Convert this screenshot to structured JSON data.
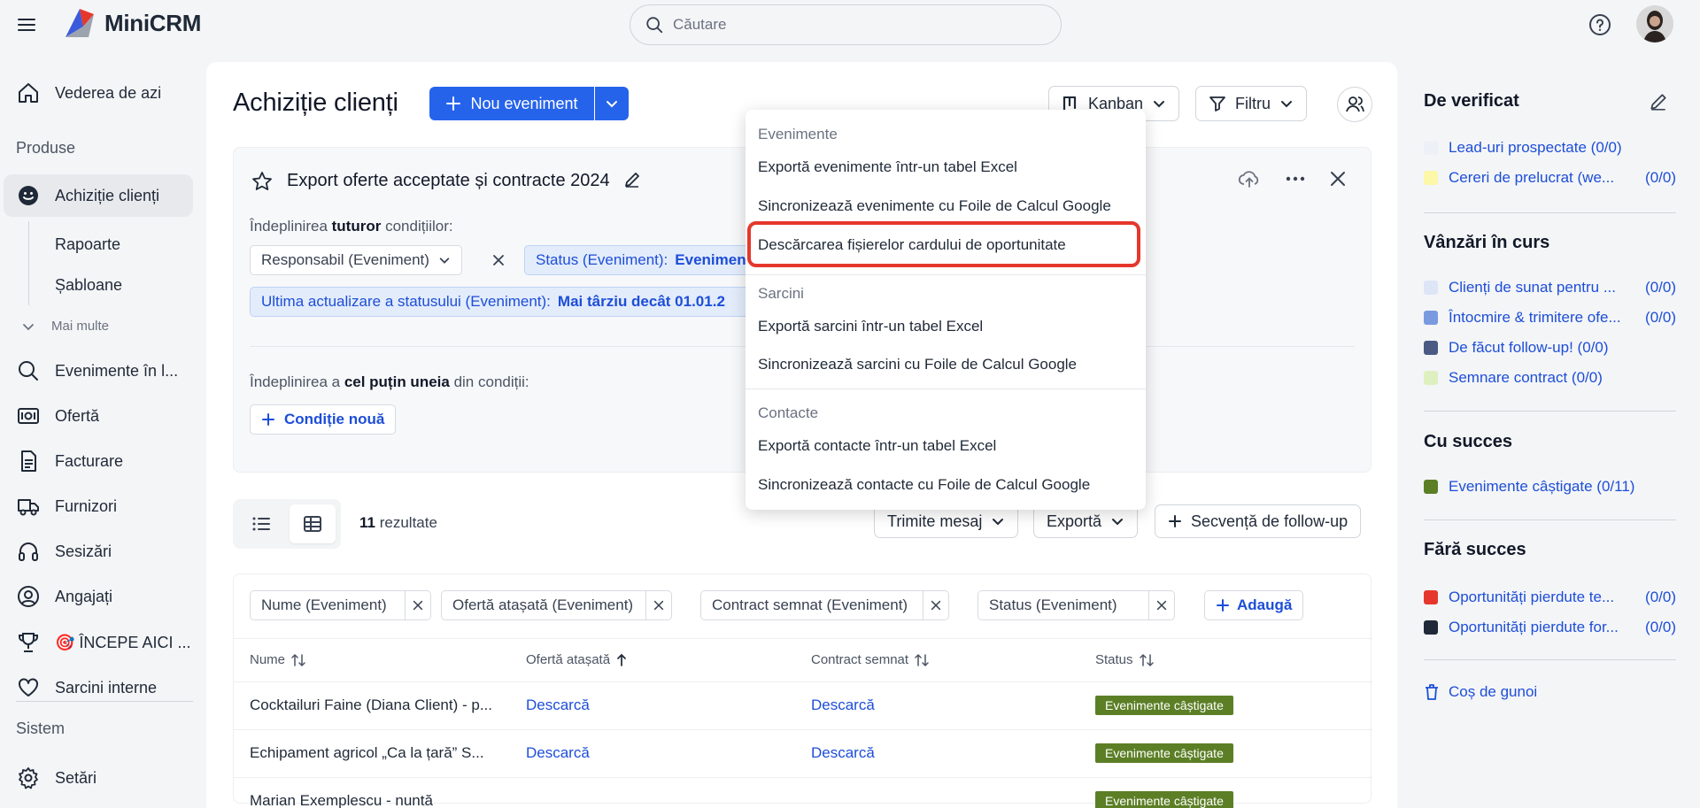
{
  "app": {
    "name": "MiniCRM",
    "search_placeholder": "Căutare"
  },
  "sidebar": {
    "items": [
      {
        "label": "Vederea de azi",
        "icon": "home-icon"
      },
      {
        "label": "Achiziție clienți",
        "icon": "smiley-icon",
        "active": true
      },
      {
        "label": "Evenimente în l...",
        "icon": "search-icon"
      },
      {
        "label": "Ofertă",
        "icon": "offer-icon"
      },
      {
        "label": "Facturare",
        "icon": "document-icon"
      },
      {
        "label": "Furnizori",
        "icon": "truck-icon"
      },
      {
        "label": "Sesizări",
        "icon": "headset-icon"
      },
      {
        "label": "Angajați",
        "icon": "user-circle-icon"
      },
      {
        "label": "🎯 ÎNCEPE AICI ...",
        "icon": "trophy-icon"
      },
      {
        "label": "Sarcini interne",
        "icon": "heart-icon"
      },
      {
        "label": "Setări",
        "icon": "gear-icon"
      }
    ],
    "section_products": "Produse",
    "section_system": "Sistem",
    "sub_items": [
      "Rapoarte",
      "Șabloane"
    ],
    "more": "Mai multe"
  },
  "main": {
    "title": "Achiziție clienți",
    "new_event": "Nou eveniment",
    "kanban": "Kanban",
    "filter": "Filtru",
    "filter_panel": {
      "title": "Export oferte acceptate și contracte 2024",
      "all_prefix": "Îndeplinirea",
      "all_bold": "tuturor",
      "all_suffix": "condițiilor:",
      "chip_responsible": "Responsabil (Eveniment)",
      "chip_status_label": "Status (Eveniment):",
      "chip_status_value": "Evenimente",
      "chip_update_label": "Ultima actualizare a statusului (Eveniment):",
      "chip_update_value": "Mai târziu decât 01.01.2",
      "any_prefix": "Îndeplinirea a",
      "any_bold": "cel puțin uneia",
      "any_suffix": "din condiții:",
      "new_condition": "Condiție nouă"
    },
    "results_count": "11",
    "results_label": "rezultate",
    "send_message": "Trimite mesaj",
    "export": "Exportă",
    "followup": "Secvență de follow-up",
    "column_chips": [
      "Nume (Eveniment)",
      "Ofertă atașată (Eveniment)",
      "Contract semnat (Eveniment)",
      "Status (Eveniment)"
    ],
    "add_column": "Adaugă",
    "table": {
      "headers": [
        "Nume",
        "Ofertă atașată",
        "Contract semnat",
        "Status"
      ],
      "rows": [
        {
          "name": "Cocktailuri Faine (Diana Client) - p...",
          "offer": "Descarcă",
          "contract": "Descarcă",
          "status": "Evenimente câștigate"
        },
        {
          "name": "Echipament agricol „Ca la țară” S...",
          "offer": "Descarcă",
          "contract": "Descarcă",
          "status": "Evenimente câștigate"
        },
        {
          "name": "Marian Exemplescu - nuntă",
          "offer": "",
          "contract": "",
          "status": "Evenimente câștigate"
        }
      ]
    }
  },
  "menu": {
    "groups": [
      {
        "header": "Evenimente",
        "items": [
          "Exportă evenimente într-un tabel Excel",
          "Sincronizează evenimente cu Foile de Calcul Google",
          "Descărcarea fișierelor cardului de oportunitate"
        ]
      },
      {
        "header": "Sarcini",
        "items": [
          "Exportă sarcini într-un tabel Excel",
          "Sincronizează sarcini cu Foile de Calcul Google"
        ]
      },
      {
        "header": "Contacte",
        "items": [
          "Exportă contacte într-un tabel Excel",
          "Sincronizează contacte cu Foile de Calcul Google"
        ]
      }
    ],
    "highlight_color": "#e5372c"
  },
  "right": {
    "sections": [
      {
        "title": "De verificat",
        "items": [
          {
            "label": "Lead-uri prospectate",
            "count": "(0/0)",
            "color": "#eef0f8"
          },
          {
            "label": "Cereri de prelucrat (we...",
            "count": "(0/0)",
            "color": "#fdf7a8"
          }
        ]
      },
      {
        "title": "Vânzări în curs",
        "items": [
          {
            "label": "Clienți de sunat pentru ...",
            "count": "(0/0)",
            "color": "#dde5f7"
          },
          {
            "label": "Întocmire & trimitere ofe...",
            "count": "(0/0)",
            "color": "#7a9ae0"
          },
          {
            "label": "De făcut follow-up!",
            "count": "(0/0)",
            "color": "#4a5a82"
          },
          {
            "label": "Semnare contract",
            "count": "(0/0)",
            "color": "#dff0c0"
          }
        ]
      },
      {
        "title": "Cu succes",
        "items": [
          {
            "label": "Evenimente câștigate",
            "count": "(0/11)",
            "color": "#5c7f26"
          }
        ]
      },
      {
        "title": "Fără succes",
        "items": [
          {
            "label": "Oportunități pierdute te...",
            "count": "(0/0)",
            "color": "#e5372c"
          },
          {
            "label": "Oportunități pierdute for...",
            "count": "(0/0)",
            "color": "#1f2937"
          }
        ]
      }
    ],
    "trash": "Coș de gunoi"
  }
}
